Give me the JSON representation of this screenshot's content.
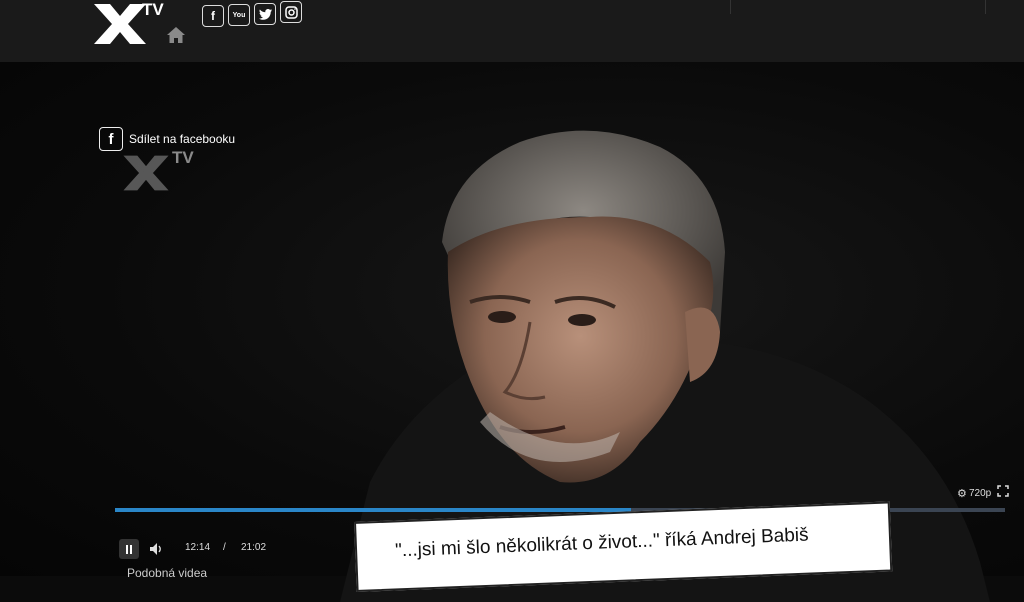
{
  "header": {
    "logo_text": "TV",
    "social": {
      "facebook": "f",
      "youtube": "You",
      "twitter": "t",
      "instagram": "ig"
    }
  },
  "player": {
    "share_label": "Sdílet na facebooku",
    "watermark_text": "TV",
    "progress": 0.58,
    "time_current": "12:14",
    "time_separator": "/",
    "time_duration": "21:02",
    "quality": "720p",
    "gear_glyph": "⚙"
  },
  "below": {
    "similar_label": "Podobná videa",
    "title": "\"...jsi mi šlo několikrát o život...\" říká Andrej Babiš"
  },
  "icons": [
    "x-logo-icon",
    "home-icon",
    "facebook-icon",
    "youtube-icon",
    "twitter-icon",
    "instagram-icon",
    "pause-icon",
    "volume-icon",
    "gear-icon",
    "fullscreen-icon"
  ],
  "colors": {
    "progress_fill": "#2a86c8",
    "progress_track": "#3b4553",
    "background": "#0b0b0b"
  }
}
